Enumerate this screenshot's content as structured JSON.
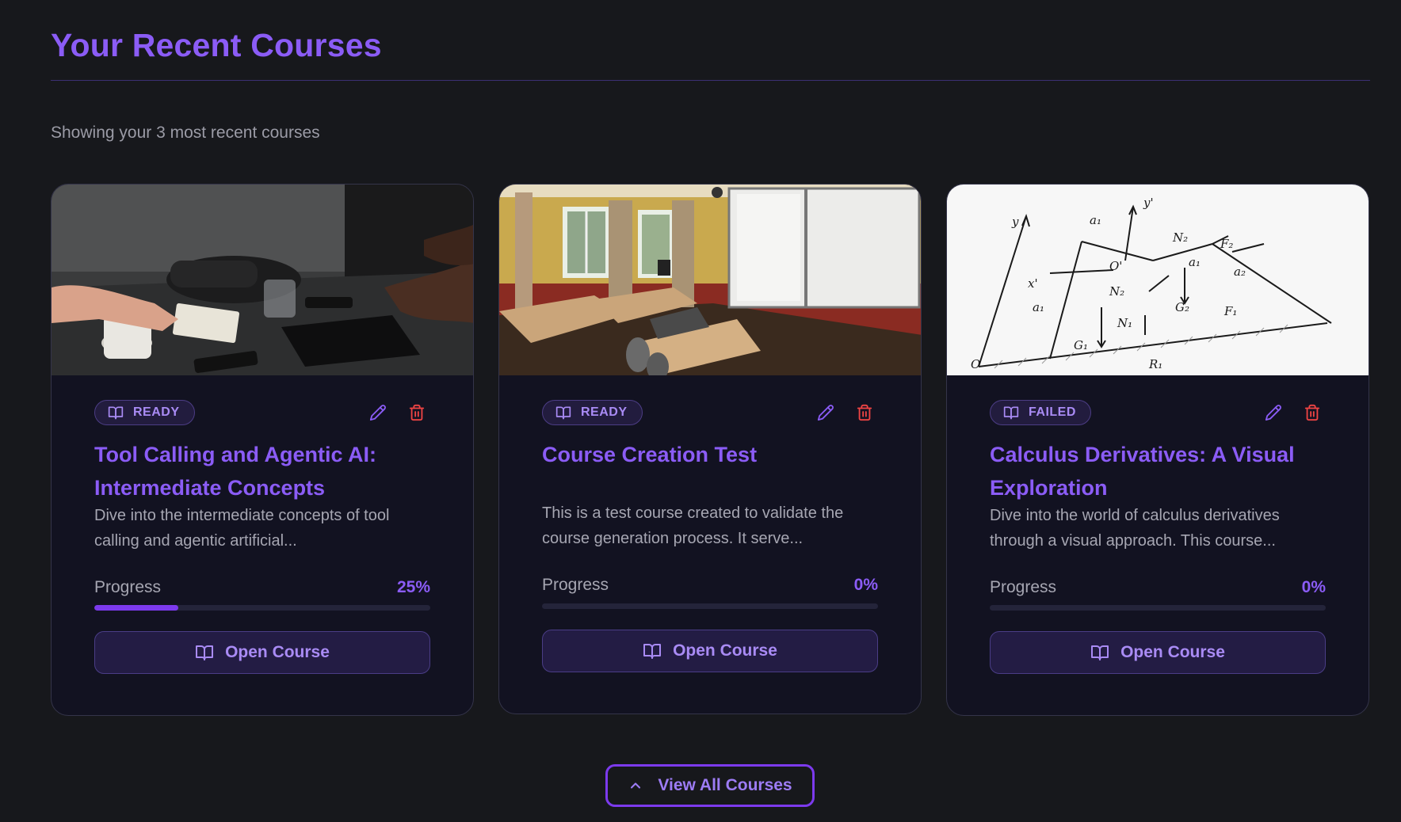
{
  "page": {
    "title": "Your Recent Courses",
    "subtitle": "Showing your 3 most recent courses"
  },
  "colors": {
    "background": "#17181c",
    "card": "#121221",
    "accent": "#8b5cf6",
    "delete": "#ef4444"
  },
  "courses": [
    {
      "status": "READY",
      "title": "Tool Calling and Agentic AI: Intermediate Concepts",
      "description": "Dive into the intermediate concepts of tool calling and agentic artificial...",
      "progress_label": "Progress",
      "progress_text": "25%",
      "progress": 0.25,
      "open_label": "Open Course",
      "image": "meeting-table-photo"
    },
    {
      "status": "READY",
      "title": "Course Creation Test",
      "description": "This is a test course created to validate the course generation process. It serve...",
      "progress_label": "Progress",
      "progress_text": "0%",
      "progress": 0,
      "open_label": "Open Course",
      "image": "classroom-photo"
    },
    {
      "status": "FAILED",
      "title": "Calculus Derivatives: A Visual Exploration",
      "description": "Dive into the world of calculus derivatives through a visual approach. This course...",
      "progress_label": "Progress",
      "progress_text": "0%",
      "progress": 0,
      "open_label": "Open Course",
      "image": "physics-diagram-photo"
    }
  ],
  "icons": {
    "badge": "book-open-icon",
    "edit": "pencil-icon",
    "delete": "trash-icon",
    "open": "book-open-icon",
    "view_all": "chevron-up-icon"
  },
  "footer": {
    "view_all_label": "View All Courses"
  }
}
